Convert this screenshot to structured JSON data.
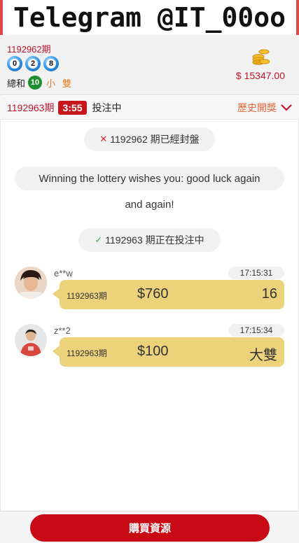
{
  "banner": {
    "text": "Telegram @IT_00oo"
  },
  "last_result": {
    "period": "1192962期",
    "balls": [
      "0",
      "2",
      "8"
    ],
    "sum_label": "總和",
    "sum_value": "10",
    "size": "小",
    "parity": "雙"
  },
  "account": {
    "balance": "$ 15347.00",
    "icon": "coins-icon"
  },
  "status": {
    "period": "1192963期",
    "countdown": "3:55",
    "state": "投注中",
    "history_label": "歷史開獎",
    "history_icon": "chevron-down-icon"
  },
  "notices": {
    "closed": "1192962 期已經封盤",
    "wish_line1": "Winning the lottery wishes you: good luck again",
    "wish_line2": "and again!",
    "open": "1192963 期正在投注中"
  },
  "bets": [
    {
      "user": "e**w",
      "time": "17:15:31",
      "period": "1192963期",
      "amount": "$760",
      "pick": "16"
    },
    {
      "user": "z**2",
      "time": "17:15:34",
      "period": "1192963期",
      "amount": "$100",
      "pick": "大雙"
    }
  ],
  "bottom": {
    "buy_label": "購買資源"
  },
  "colors": {
    "accent_red": "#c80a14",
    "bubble_gold": "#ecd27b",
    "sum_green": "#1e8e2e",
    "orange": "#e27a1f"
  }
}
